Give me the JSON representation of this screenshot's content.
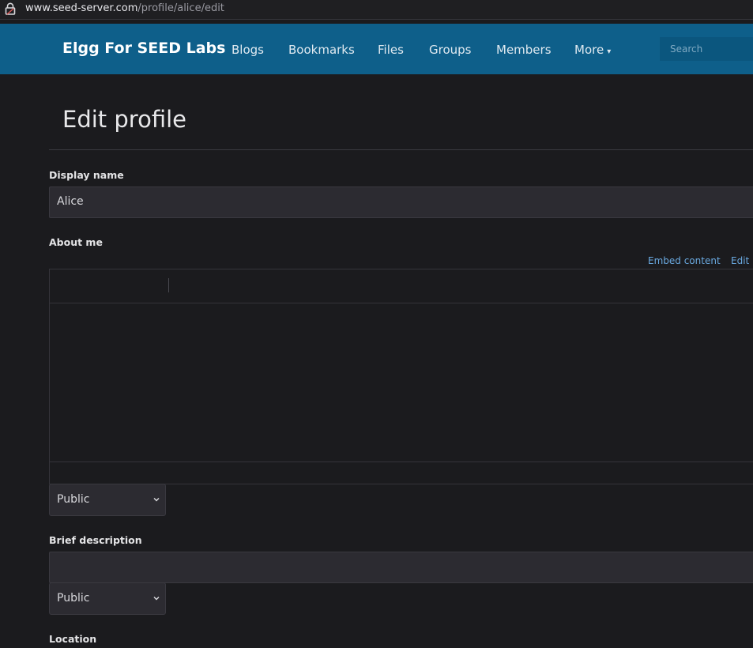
{
  "browser": {
    "url_host": "www.seed-server.com",
    "url_path": "/profile/alice/edit"
  },
  "header": {
    "brand": "Elgg For SEED Labs",
    "nav": [
      "Blogs",
      "Bookmarks",
      "Files",
      "Groups",
      "Members",
      "More"
    ],
    "search_placeholder": "Search"
  },
  "page": {
    "title": "Edit profile"
  },
  "form": {
    "display_name": {
      "label": "Display name",
      "value": "Alice"
    },
    "about_me": {
      "label": "About me",
      "embed_link": "Embed content",
      "edit_link": "Edit",
      "access": "Public"
    },
    "brief_description": {
      "label": "Brief description",
      "value": "",
      "access": "Public"
    },
    "location": {
      "label": "Location"
    }
  },
  "colors": {
    "header_bg": "#0e5f8a",
    "page_bg": "#1b1b1e",
    "link": "#6aa9e0"
  }
}
